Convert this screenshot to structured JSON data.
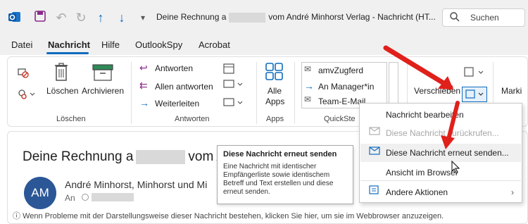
{
  "titlebar": {
    "app_icon": "outlook-icon",
    "save_icon": "save-icon",
    "undo_icon": "undo-icon",
    "redo_icon": "redo-icon",
    "up_icon": "arrow-up-icon",
    "down_icon": "arrow-down-icon",
    "customize_icon": "customize-toolbar-icon",
    "title_pre": "Deine Rechnung a",
    "title_post": "vom André Minhorst Verlag  -  Nachricht (HT...",
    "search_placeholder": "Suchen"
  },
  "menu": {
    "items": [
      "Datei",
      "Nachricht",
      "Hilfe",
      "OutlookSpy",
      "Acrobat"
    ],
    "active": "Nachricht"
  },
  "ribbon": {
    "loeschen_group": {
      "label": "Löschen",
      "ignore_icon": "ignore-icon",
      "cleanup_icon": "cleanup-icon",
      "delete_label": "Löschen",
      "archive_label": "Archivieren"
    },
    "antworten_group": {
      "label": "Antworten",
      "reply": "Antworten",
      "reply_all": "Allen antworten",
      "forward": "Weiterleiten"
    },
    "apps_group": {
      "label": "Apps",
      "all_apps_line1": "Alle",
      "all_apps_line2": "Apps"
    },
    "quicksteps_group": {
      "label": "QuickSte",
      "items": [
        "amvZugferd",
        "An Manager*in",
        "Team-E-Mail"
      ]
    },
    "move_group": {
      "move_label": "Verschieben",
      "marki_label": "Marki"
    }
  },
  "message": {
    "subject_pre": "Deine Rechnung a",
    "subject_post": "vom Ar",
    "avatar_initials": "AM",
    "sender": "André Minhorst, Minhorst und Mi",
    "to_label": "An",
    "info_text": "Wenn Probleme mit der Darstellungsweise dieser Nachricht bestehen, klicken Sie hier, um sie im Webbrowser anzuzeigen."
  },
  "tooltip": {
    "title": "Diese Nachricht erneut senden",
    "body": "Eine Nachricht mit identischer Empfängerliste sowie identischem Betreff und Text erstellen und diese erneut senden."
  },
  "dropdown": {
    "items": [
      {
        "label": "Nachricht bearbeiten",
        "icon": "",
        "disabled": false
      },
      {
        "label": "Diese Nachricht zurückrufen...",
        "icon": "recall-icon",
        "disabled": true
      },
      {
        "label": "Diese Nachricht erneut senden...",
        "icon": "resend-icon",
        "disabled": false
      },
      {
        "label": "Ansicht im Browser",
        "icon": "",
        "disabled": false
      },
      {
        "label": "Andere Aktionen",
        "icon": "other-actions-icon",
        "disabled": false
      }
    ]
  },
  "colors": {
    "accent": "#0f6cbd",
    "avatar": "#2b5797",
    "annotation_arrow": "#e0201b"
  }
}
